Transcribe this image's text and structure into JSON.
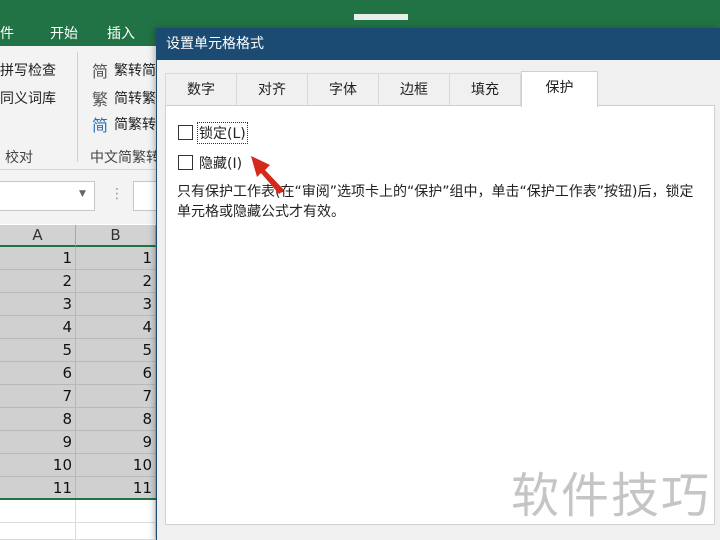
{
  "ribbon": {
    "tabs": [
      "件",
      "开始",
      "插入"
    ],
    "proofing": {
      "spell": "拼写检查",
      "thesaurus": "同义词库",
      "group": "校对"
    },
    "chinese": {
      "t2s": "繁转简",
      "s2t": "简转繁",
      "convert": "简繁转",
      "group": "中文简繁转"
    }
  },
  "sheet": {
    "columns": [
      "A",
      "B"
    ],
    "rows": [
      [
        "1",
        "1"
      ],
      [
        "2",
        "2"
      ],
      [
        "3",
        "3"
      ],
      [
        "4",
        "4"
      ],
      [
        "5",
        "5"
      ],
      [
        "6",
        "6"
      ],
      [
        "7",
        "7"
      ],
      [
        "8",
        "8"
      ],
      [
        "9",
        "9"
      ],
      [
        "10",
        "10"
      ],
      [
        "11",
        "11"
      ]
    ]
  },
  "dialog": {
    "title": "设置单元格格式",
    "tabs": [
      "数字",
      "对齐",
      "字体",
      "边框",
      "填充",
      "保护"
    ],
    "active_tab": "保护",
    "locked": {
      "label": "锁定(L)",
      "checked": false
    },
    "hidden": {
      "label": "隐藏(I)",
      "checked": false
    },
    "description": "只有保护工作表(在“审阅”选项卡上的“保护”组中，单击“保护工作表”按钮)后，锁定单元格或隐藏公式才有效。"
  },
  "watermark": "软件技巧",
  "colors": {
    "excel_green": "#217346",
    "dialog_title": "#1b4a72",
    "arrow": "#d42a1c"
  }
}
